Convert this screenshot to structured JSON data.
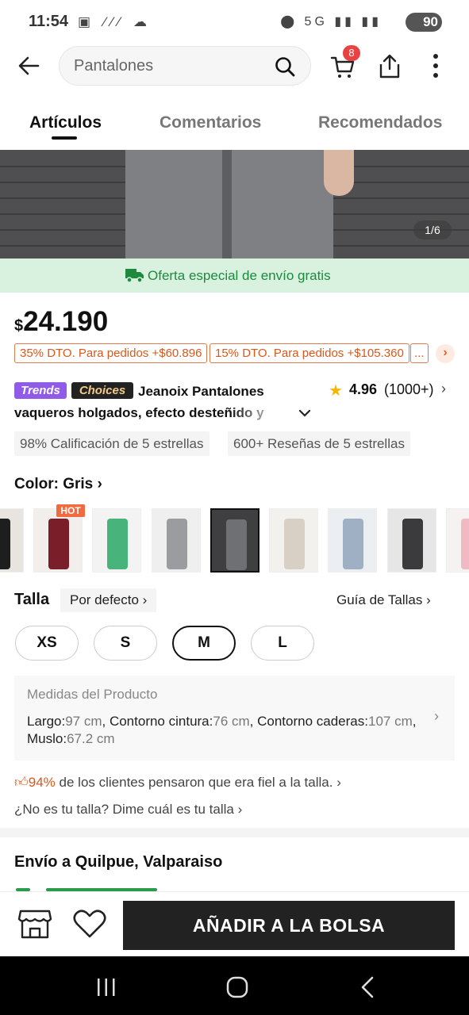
{
  "status_bar": {
    "time": "11:54",
    "left_icons": "▣ ⁄⁄⁄ ☁",
    "right_icons": "⬤ 5G ▮▮ ▮▮",
    "battery": "90"
  },
  "top_nav": {
    "search_placeholder": "Pantalones",
    "cart_count": "8"
  },
  "tabs": [
    {
      "label": "Artículos",
      "active": true
    },
    {
      "label": "Comentarios",
      "active": false
    },
    {
      "label": "Recomendados",
      "active": false
    }
  ],
  "gallery": {
    "pager": "1/6"
  },
  "shipping_banner": "Oferta especial de envío gratis",
  "price": {
    "currency": "$",
    "value": "24.190"
  },
  "coupons": [
    "35% DTO. Para pedidos +$60.896",
    "15% DTO. Para pedidos +$105.360",
    "..."
  ],
  "product": {
    "badge_trends": "Trends",
    "badge_choices": "Choices",
    "title_line1": "Jeanoix Pantalones",
    "title_line2": "vaqueros holgados, efecto desteñido y",
    "rating": "4.96",
    "rating_count": "(1000+)"
  },
  "chips": [
    "98% Calificación de 5 estrellas",
    "600+ Reseñas de 5 estrellas"
  ],
  "color": {
    "label": "Color: Gris",
    "hot_label": "HOT",
    "swatches": [
      {
        "name": "black",
        "color": "#1e1e1e",
        "bg": "#e8e4e0"
      },
      {
        "name": "burgundy",
        "color": "#7a1f2a",
        "bg": "#f1eeec"
      },
      {
        "name": "green",
        "color": "#48b37a",
        "bg": "#f3f3f3"
      },
      {
        "name": "light-gray",
        "color": "#9a9c9f",
        "bg": "#efefef"
      },
      {
        "name": "gray",
        "color": "#6e7074",
        "bg": "#3f3f42"
      },
      {
        "name": "beige",
        "color": "#d8d0c4",
        "bg": "#f2f1ee"
      },
      {
        "name": "light-blue",
        "color": "#9fb0c4",
        "bg": "#eceff2"
      },
      {
        "name": "dark-gray",
        "color": "#3b3b3d",
        "bg": "#e6e6e6"
      },
      {
        "name": "pink",
        "color": "#f0b9c4",
        "bg": "#f6f2f2"
      }
    ]
  },
  "size": {
    "label": "Talla",
    "default_label": "Por defecto",
    "guide_label": "Guía de Tallas",
    "options": [
      "XS",
      "S",
      "M",
      "L"
    ],
    "selected": "M"
  },
  "measurements": {
    "title": "Medidas del Producto",
    "l1": "Largo:",
    "v1": "97 cm",
    "l2": "Contorno cintura:",
    "v2": "76 cm",
    "l3": "Contorno caderas:",
    "v3": "107 cm",
    "l4": "Muslo:",
    "v4": "67.2 cm"
  },
  "fit": {
    "percent": "94%",
    "text": "de los clientes pensaron que era fiel a la talla.",
    "not_fit": "¿No es tu talla? Dime cuál es tu talla"
  },
  "shipping_to": "Envío a Quilpue, Valparaiso",
  "bottom": {
    "add_label": "AÑADIR A LA BOLSA"
  }
}
